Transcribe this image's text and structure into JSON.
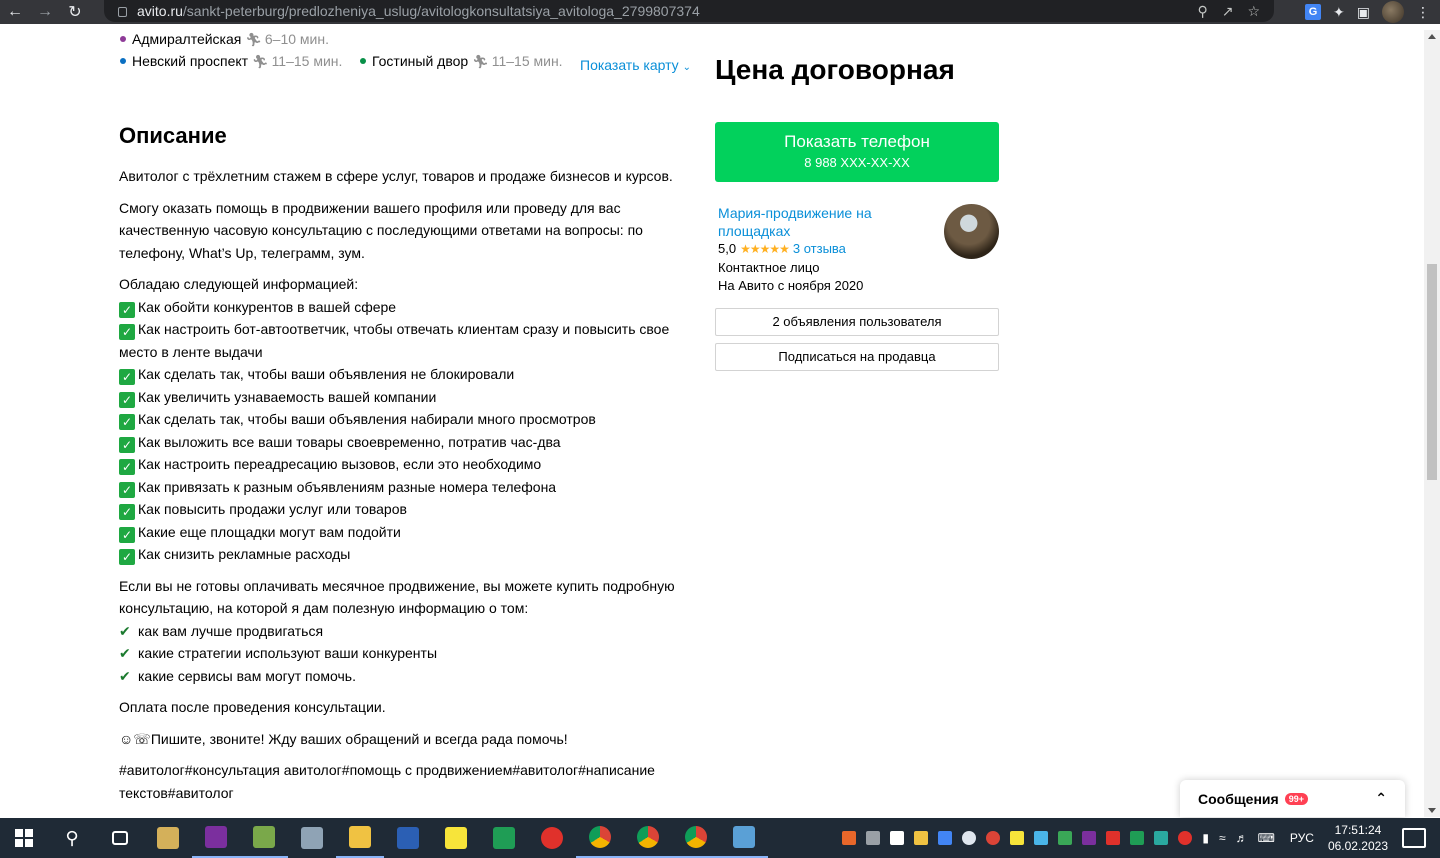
{
  "browser": {
    "url_host": "avito.ru",
    "url_path": "/sankt-peterburg/predlozheniya_uslug/avitologkonsultatsiya_avitologa_2799807374"
  },
  "metro": [
    {
      "name": "Адмиралтейская",
      "time": "6–10 мин.",
      "color": "#8e3b98"
    },
    {
      "name": "Невский проспект",
      "time": "11–15 мин.",
      "color": "#0a6fc2"
    },
    {
      "name": "Гостиный двор",
      "time": "11–15 мин.",
      "color": "#089048"
    }
  ],
  "show_map": "Показать карту",
  "description": {
    "title": "Описание",
    "p1": "Авитолог с трёхлетним стажем в сфере услуг, товаров и продаже бизнесов и курсов.",
    "p2": "Смогу оказать помощь в продвижении вашего профиля или проведу для вас качественную часовую консультацию с последующими ответами на вопросы: по телефону, What’s Up, телеграмм, зум.",
    "intro": "Обладаю следующей информацией:",
    "items": [
      "Как обойти конкурентов в вашей сфере",
      "Как настроить бот-автоответчик, чтобы отвечать клиентам сразу и повысить свое место в ленте выдачи",
      "Как сделать так, чтобы ваши объявления не блокировали",
      "Как увеличить узнаваемость вашей компании",
      "Как сделать так, чтобы ваши объявления набирали много просмотров",
      "Как выложить все ваши товары своевременно, потратив час-два",
      "Как настроить переадресацию вызовов, если это необходимо",
      "Как привязать к разным объявлениям разные номера телефона",
      "Как повысить продажи услуг или товаров",
      "Какие еще площадки могут вам подойти",
      "Как снизить рекламные расходы"
    ],
    "p3": "Если вы не готовы оплачивать месячное продвижение, вы можете купить подробную консультацию, на которой я дам полезную информацию о том:",
    "ticks": [
      "как вам лучше продвигаться",
      "какие стратегии используют ваши конкуренты",
      "какие сервисы вам могут помочь."
    ],
    "p4": "Оплата после проведения консультации.",
    "p5": "Пишите, звоните! Жду ваших обращений и всегда рада помочь!",
    "p6": "#авитолог#консультация авитолог#помощь с продвижением#авитолог#написание текстов#авитолог"
  },
  "seller": {
    "price": "Цена договорная",
    "phone_label": "Показать телефон",
    "phone_masked": "8 988 XXX-XX-XX",
    "name": "Мария-продвижение на площадках",
    "rating": "5,0",
    "reviews": "3 отзыва",
    "role": "Контактное лицо",
    "since": "На Авито с ноября 2020",
    "ads_button": "2 объявления пользователя",
    "subscribe_button": "Подписаться на продавца"
  },
  "messages": {
    "title": "Сообщения",
    "badge": "99+"
  },
  "taskbar": {
    "lang": "РУС",
    "time": "17:51:24",
    "date": "06.02.2023"
  }
}
